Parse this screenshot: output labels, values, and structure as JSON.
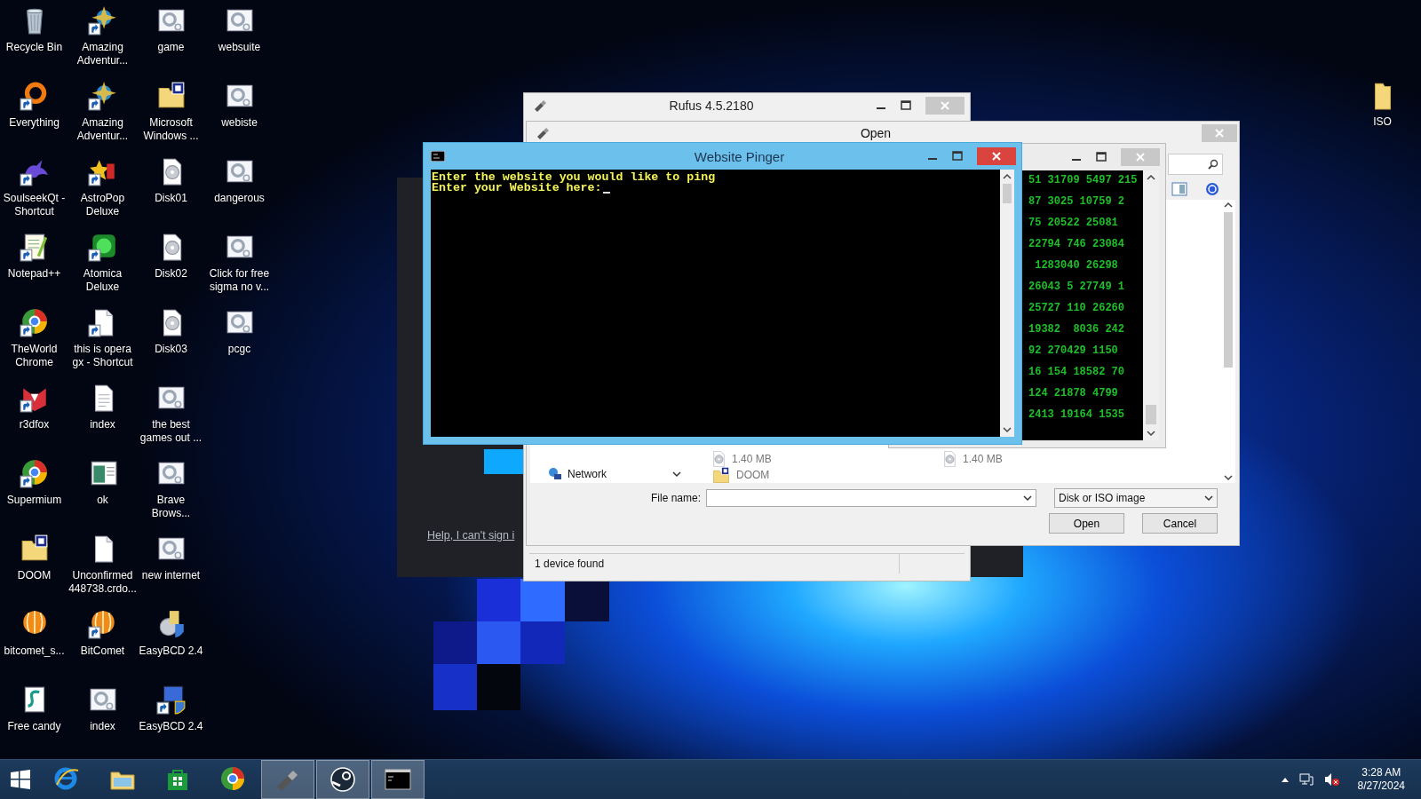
{
  "desktop_icons": [
    {
      "label": "Recycle Bin",
      "kind": "bin",
      "shortcut": false
    },
    {
      "label": "Everything",
      "kind": "ring",
      "shortcut": true
    },
    {
      "label": "SoulseekQt - Shortcut",
      "kind": "bird",
      "shortcut": true
    },
    {
      "label": "Notepad++",
      "kind": "notepad",
      "shortcut": true
    },
    {
      "label": "TheWorld Chrome",
      "kind": "globe",
      "shortcut": true
    },
    {
      "label": "r3dfox",
      "kind": "fox",
      "shortcut": true
    },
    {
      "label": "Supermium",
      "kind": "globe",
      "shortcut": true
    },
    {
      "label": "DOOM",
      "kind": "zipfolder",
      "shortcut": false
    },
    {
      "label": "bitcomet_s...",
      "kind": "orb",
      "shortcut": false
    },
    {
      "label": "Free candy",
      "kind": "script",
      "shortcut": false
    },
    {
      "label": "Amazing Adventur...",
      "kind": "compass",
      "shortcut": true
    },
    {
      "label": "Amazing Adventur...",
      "kind": "compass",
      "shortcut": true
    },
    {
      "label": "AstroPop Deluxe",
      "kind": "astro",
      "shortcut": true
    },
    {
      "label": "Atomica Deluxe",
      "kind": "atom",
      "shortcut": true
    },
    {
      "label": "this is opera gx - Shortcut",
      "kind": "file",
      "shortcut": true
    },
    {
      "label": "index",
      "kind": "doc",
      "shortcut": false
    },
    {
      "label": "ok",
      "kind": "window",
      "shortcut": false
    },
    {
      "label": "Unconfirmed 448738.crdo...",
      "kind": "file",
      "shortcut": false
    },
    {
      "label": "BitComet",
      "kind": "orb",
      "shortcut": true
    },
    {
      "label": "index",
      "kind": "web",
      "shortcut": false
    },
    {
      "label": "game",
      "kind": "web",
      "shortcut": false
    },
    {
      "label": "Microsoft Windows ...",
      "kind": "zipfolder",
      "shortcut": false
    },
    {
      "label": "Disk01",
      "kind": "disc",
      "shortcut": false
    },
    {
      "label": "Disk02",
      "kind": "disc",
      "shortcut": false
    },
    {
      "label": "Disk03",
      "kind": "disc",
      "shortcut": false
    },
    {
      "label": "the best games out ...",
      "kind": "web",
      "shortcut": false
    },
    {
      "label": "Brave Brows...",
      "kind": "web",
      "shortcut": false
    },
    {
      "label": "new internet",
      "kind": "web",
      "shortcut": false
    },
    {
      "label": "EasyBCD 2.4",
      "kind": "installer",
      "shortcut": false
    },
    {
      "label": "EasyBCD 2.4",
      "kind": "monitor",
      "shortcut": true
    },
    {
      "label": "websuite",
      "kind": "web",
      "shortcut": false
    },
    {
      "label": "webiste",
      "kind": "web",
      "shortcut": false
    },
    {
      "label": "dangerous",
      "kind": "web",
      "shortcut": false
    },
    {
      "label": "Click for free sigma no v...",
      "kind": "web",
      "shortcut": false
    },
    {
      "label": "pcgc",
      "kind": "web",
      "shortcut": false
    }
  ],
  "desktop_icons_right": [
    {
      "label": "ISO",
      "kind": "folder",
      "shortcut": false
    }
  ],
  "background_window": {
    "link": "Help, I can't sign i"
  },
  "rufus_window": {
    "title": "Rufus 4.5.2180",
    "status": "1 device found"
  },
  "open_dialog": {
    "title": "Open",
    "nav_items": [
      {
        "label": "Network"
      }
    ],
    "files": [
      {
        "text": "1.40 MB",
        "kind": "disc"
      },
      {
        "text": "1.40 MB",
        "kind": "disc"
      },
      {
        "text": "DOOM",
        "kind": "zipfolder"
      }
    ],
    "file_name_label": "File name:",
    "filter": "Disk or ISO image",
    "buttons": [
      "Open",
      "Cancel"
    ]
  },
  "number_console": {
    "lines": [
      "51 31709 5497 215",
      "87 3025 10759 2",
      "75 20522 25081",
      "22794 746 23084",
      " 1283040 26298",
      "26043 5 27749 1",
      "25727 110 26260",
      "19382  8036 242",
      "92 270429 1150",
      "16 154 18582 70",
      "124 21878 4799",
      "2413 19164 1535"
    ]
  },
  "pinger_window": {
    "title": "Website Pinger",
    "lines": [
      "Enter the website you would like to ping",
      "Enter your Website here:"
    ]
  },
  "taskbar": {
    "apps": [
      {
        "kind": "ie",
        "open": false
      },
      {
        "kind": "explorer",
        "open": false
      },
      {
        "kind": "store",
        "open": false
      },
      {
        "kind": "globe",
        "open": false
      },
      {
        "kind": "usb",
        "open": true
      },
      {
        "kind": "steam",
        "open": true
      },
      {
        "kind": "cmd",
        "open": true
      }
    ],
    "time": "3:28 AM",
    "date": "8/27/2024"
  }
}
